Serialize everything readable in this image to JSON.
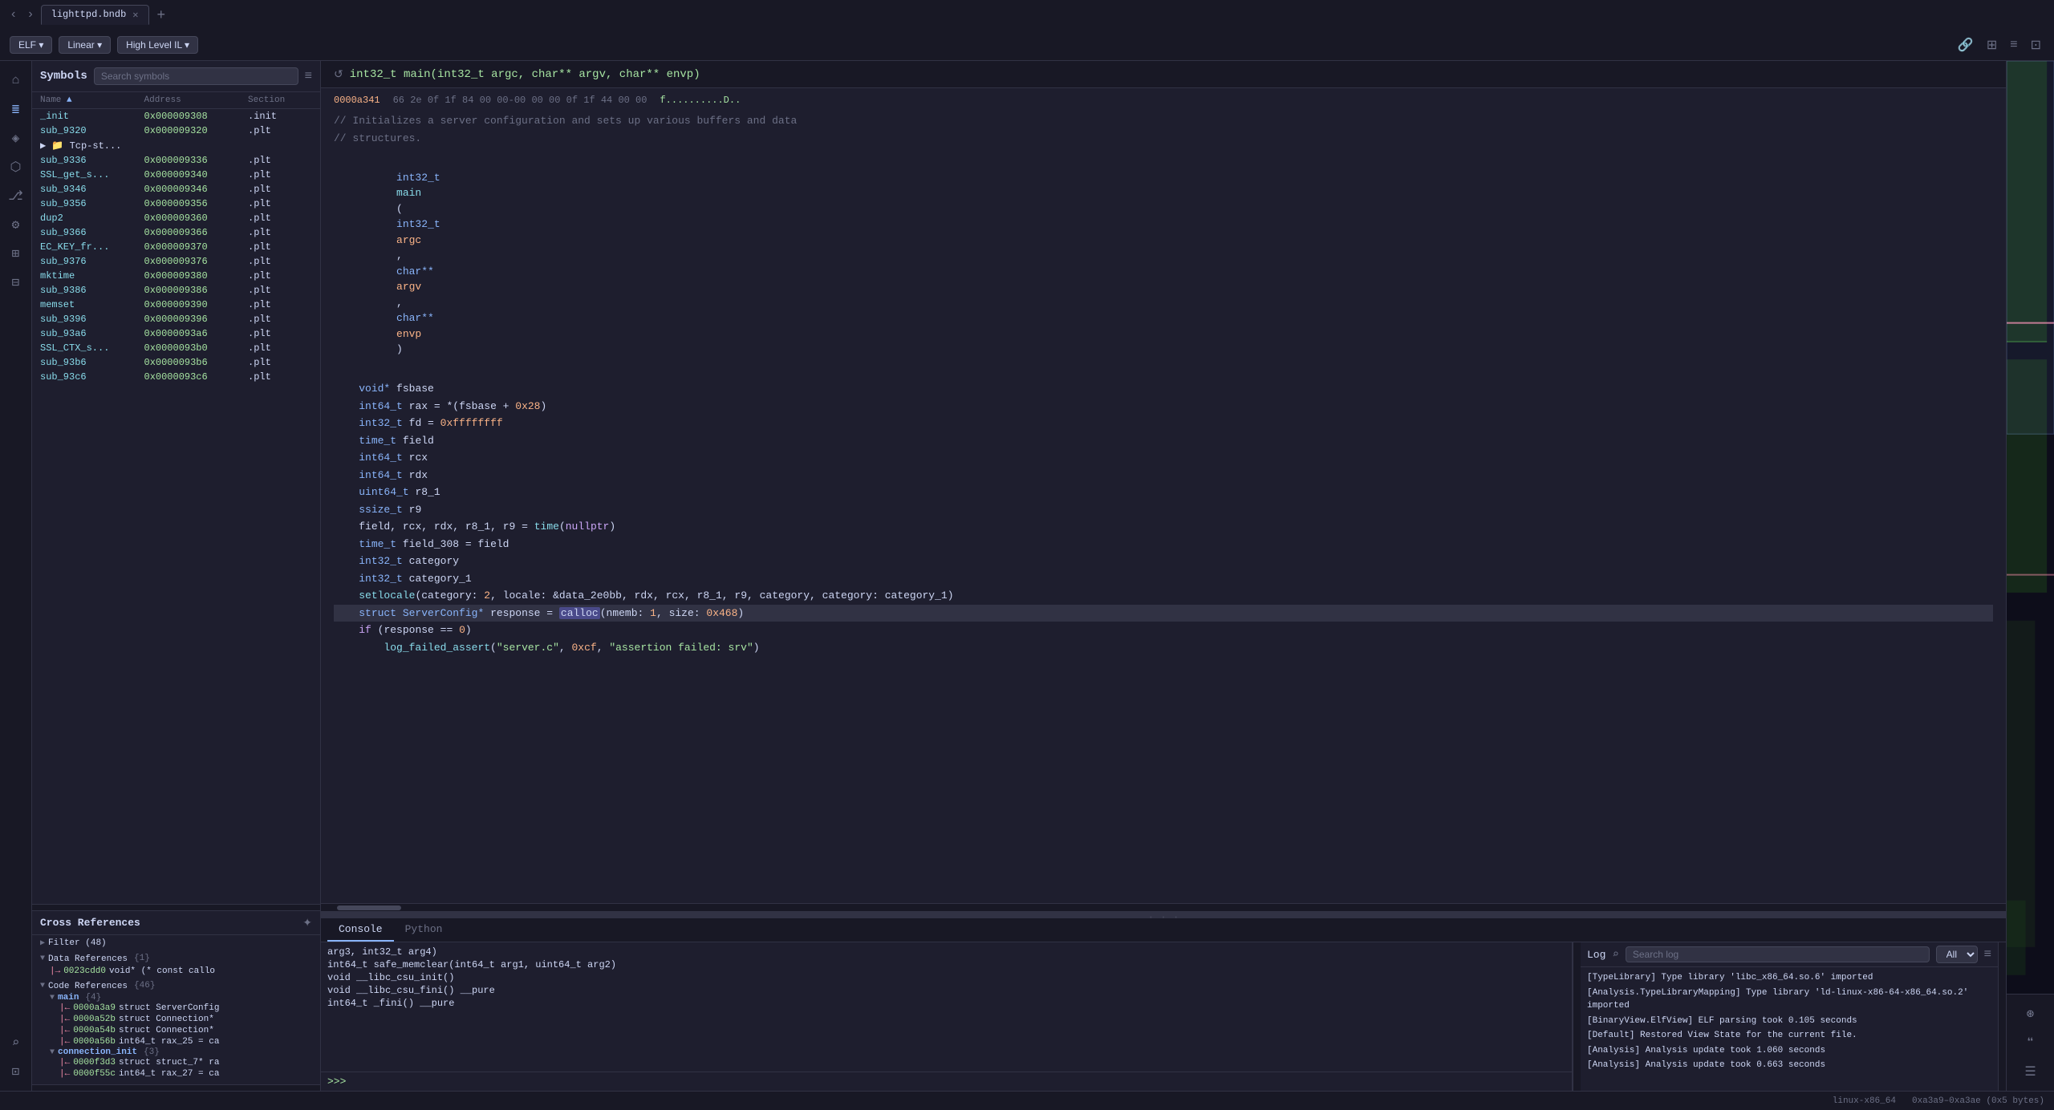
{
  "tabBar": {
    "backBtn": "‹",
    "forwardBtn": "›",
    "tabs": [
      {
        "label": "lighttpd.bndb",
        "active": true
      }
    ],
    "addTabBtn": "+"
  },
  "toolbar": {
    "elfBtn": "ELF ▾",
    "linearBtn": "Linear ▾",
    "hlilBtn": "High Level IL ▾",
    "linkIcon": "🔗",
    "columns2Icon": "⊞",
    "menuIcon": "≡",
    "pluginIcon": "⊡"
  },
  "sidebar": {
    "icons": [
      {
        "name": "home-icon",
        "glyph": "⌂",
        "active": false
      },
      {
        "name": "disasm-icon",
        "glyph": "≣",
        "active": true
      },
      {
        "name": "tag-icon",
        "glyph": "◈",
        "active": false
      },
      {
        "name": "graph-icon",
        "glyph": "⬡",
        "active": false
      },
      {
        "name": "branch-icon",
        "glyph": "⎇",
        "active": false
      },
      {
        "name": "settings-icon",
        "glyph": "⚙",
        "active": false
      },
      {
        "name": "grid-icon",
        "glyph": "⊞",
        "active": false
      },
      {
        "name": "table-icon",
        "glyph": "⊟",
        "active": false
      },
      {
        "name": "search-icon",
        "glyph": "⌕",
        "active": false
      },
      {
        "name": "terminal-icon",
        "glyph": "⊡",
        "active": false
      }
    ]
  },
  "symbolsPanel": {
    "title": "Symbols",
    "searchPlaceholder": "Search symbols",
    "menuIcon": "≡",
    "columns": [
      "Name",
      "Address",
      "Section"
    ],
    "symbols": [
      {
        "name": "_init",
        "addr": "0x000009308",
        "section": ".init",
        "indent": false,
        "folder": false
      },
      {
        "name": "sub_9320",
        "addr": "0x000009320",
        "section": ".plt",
        "indent": false,
        "folder": false
      },
      {
        "name": "Tcp-st...",
        "addr": "",
        "section": "",
        "indent": false,
        "folder": true
      },
      {
        "name": "sub_9336",
        "addr": "0x000009336",
        "section": ".plt",
        "indent": false,
        "folder": false
      },
      {
        "name": "SSL_get_s...",
        "addr": "0x000009340",
        "section": ".plt",
        "indent": false,
        "folder": false
      },
      {
        "name": "sub_9346",
        "addr": "0x000009346",
        "section": ".plt",
        "indent": false,
        "folder": false
      },
      {
        "name": "sub_9356",
        "addr": "0x000009356",
        "section": ".plt",
        "indent": false,
        "folder": false
      },
      {
        "name": "dup2",
        "addr": "0x000009360",
        "section": ".plt",
        "indent": false,
        "folder": false
      },
      {
        "name": "sub_9366",
        "addr": "0x000009366",
        "section": ".plt",
        "indent": false,
        "folder": false
      },
      {
        "name": "EC_KEY_fr...",
        "addr": "0x000009370",
        "section": ".plt",
        "indent": false,
        "folder": false
      },
      {
        "name": "sub_9376",
        "addr": "0x000009376",
        "section": ".plt",
        "indent": false,
        "folder": false
      },
      {
        "name": "mktime",
        "addr": "0x000009380",
        "section": ".plt",
        "indent": false,
        "folder": false
      },
      {
        "name": "sub_9386",
        "addr": "0x000009386",
        "section": ".plt",
        "indent": false,
        "folder": false
      },
      {
        "name": "memset",
        "addr": "0x000009390",
        "section": ".plt",
        "indent": false,
        "folder": false
      },
      {
        "name": "sub_9396",
        "addr": "0x000009396",
        "section": ".plt",
        "indent": false,
        "folder": false
      },
      {
        "name": "sub_93a6",
        "addr": "0x0000093a6",
        "section": ".plt",
        "indent": false,
        "folder": false
      },
      {
        "name": "SSL_CTX_s...",
        "addr": "0x0000093b0",
        "section": ".plt",
        "indent": false,
        "folder": false
      },
      {
        "name": "sub_93b6",
        "addr": "0x0000093b6",
        "section": ".plt",
        "indent": false,
        "folder": false
      },
      {
        "name": "sub_93c6",
        "addr": "0x0000093c6",
        "section": ".plt",
        "indent": false,
        "folder": false
      }
    ]
  },
  "crossReferences": {
    "title": "Cross References",
    "pinIcon": "📌",
    "filter": "Filter (48)",
    "dataRefs": {
      "label": "Data References",
      "count": "{1}",
      "items": [
        {
          "addr": "0023cdd0",
          "text": "void* (* const callo"
        }
      ]
    },
    "codeRefs": {
      "label": "Code References",
      "count": "{46}",
      "main": {
        "label": "main",
        "count": "{4}",
        "items": [
          {
            "addr": "0000a3a9",
            "text": "struct ServerConfig"
          },
          {
            "addr": "0000a52b",
            "text": "struct Connection*"
          },
          {
            "addr": "0000a54b",
            "text": "struct Connection*"
          },
          {
            "addr": "0000a56b",
            "text": "int64_t rax_25 = ca"
          }
        ]
      },
      "connInit": {
        "label": "connection_init",
        "count": "{3}",
        "items": [
          {
            "addr": "0000f3d3",
            "text": "struct struct_7* ra"
          },
          {
            "addr": "0000f55c",
            "text": "int64_t rax_27 = ca"
          }
        ]
      }
    }
  },
  "codeView": {
    "functionSignature": "int32_t main(int32_t argc, char** argv, char** envp)",
    "refreshIcon": "↺",
    "hexLine": {
      "addr": "0000a341",
      "bytes": "66 2e 0f 1f 84 00 00-00 00 00 0f 1f 44 00 00",
      "chars": "f..........D.."
    },
    "comments": [
      "// Initializes a server configuration and sets up various buffers and data",
      "// structures."
    ],
    "codeLines": [
      {
        "text": "int32_t main(int32_t argc, char** argv, char** envp)",
        "type": "signature"
      },
      {
        "text": "",
        "type": "empty"
      },
      {
        "text": "    void* fsbase",
        "type": "code"
      },
      {
        "text": "    int64_t rax = *(fsbase + 0x28)",
        "type": "code"
      },
      {
        "text": "    int32_t fd = 0xffffffff",
        "type": "code"
      },
      {
        "text": "    time_t field",
        "type": "code"
      },
      {
        "text": "    int64_t rcx",
        "type": "code"
      },
      {
        "text": "    int64_t rdx",
        "type": "code"
      },
      {
        "text": "    uint64_t r8_1",
        "type": "code"
      },
      {
        "text": "    ssize_t r9",
        "type": "code"
      },
      {
        "text": "    field, rcx, rdx, r8_1, r9 = time(nullptr)",
        "type": "code"
      },
      {
        "text": "    time_t field_308 = field",
        "type": "code"
      },
      {
        "text": "    int32_t category",
        "type": "code"
      },
      {
        "text": "    int32_t category_1",
        "type": "code"
      },
      {
        "text": "    setlocale(category: 2, locale: &data_2e0bb, rdx, rcx, r8_1, r9, category, category: category_1)",
        "type": "code"
      },
      {
        "text": "    struct ServerConfig* response = calloc(nmemb: 1, size: 0x468)",
        "type": "code-highlight"
      },
      {
        "text": "    if (response == 0)",
        "type": "code"
      },
      {
        "text": "        log_failed_assert(\"server.c\", 0xcf, \"assertion failed: srv\")",
        "type": "code"
      }
    ]
  },
  "bottomPanel": {
    "tabs": [
      "Console",
      "Python"
    ],
    "activeTab": "Console",
    "consoleLines": [
      "arg3, int32_t arg4)",
      "int64_t safe_memclear(int64_t arg1, uint64_t arg2)",
      "void __libc_csu_init()",
      "void __libc_csu_fini() __pure",
      "int64_t _fini() __pure"
    ],
    "prompt": ">>>",
    "logPanel": {
      "title": "Log",
      "searchPlaceholder": "Search log",
      "filterDefault": "All",
      "menuIcon": "≡",
      "lines": [
        "[TypeLibrary] Type library 'libc_x86_64.so.6' imported",
        "[Analysis.TypeLibraryMapping] Type library 'ld-linux-x86-64-x86_64.so.2' imported",
        "[BinaryView.ElfView] ELF parsing took 0.105 seconds",
        "[Default] Restored View State for the current file.",
        "[Analysis] Analysis update took 1.060 seconds",
        "[Analysis] Analysis update took 0.663 seconds"
      ]
    }
  },
  "statusBar": {
    "arch": "linux-x86_64",
    "range": "0xa3a9–0xa3ae (0x5 bytes)"
  },
  "minimap": {
    "highlights": []
  }
}
